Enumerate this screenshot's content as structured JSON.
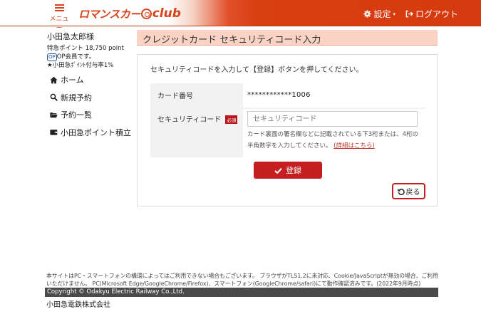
{
  "header": {
    "menu_label": "メニュー",
    "logo_romance": "ロマンスカー",
    "logo_club": "club",
    "settings_label": "設定",
    "logout_label": "ログアウト"
  },
  "user": {
    "name": "小田急太郎様",
    "points_line": "特急ポイント 18,750 point",
    "op_badge": "OP",
    "member_line": "OP会員です。",
    "rate_line": "★小田急ﾎﾟｲﾝﾄ付与率1%"
  },
  "sidebar": {
    "items": [
      {
        "label": "ホーム"
      },
      {
        "label": "新規予約"
      },
      {
        "label": "予約一覧"
      },
      {
        "label": "小田急ポイント積立"
      }
    ]
  },
  "page": {
    "title": "クレジットカード セキュリティコード入力",
    "intro": "セキュリティコードを入力して【登録】ボタンを押してください。"
  },
  "form": {
    "card_number_label": "カード番号",
    "card_number_value": "************1006",
    "security_code_label": "セキュリティコード",
    "required_badge": "必須",
    "security_code_placeholder": "セキュリティコード",
    "help_text": "カード裏面の署名欄などに記載されている下3桁または、4桁の半角数字を入力してください。",
    "help_link": "(詳細はこちら)"
  },
  "buttons": {
    "register": "登録",
    "back": "戻る"
  },
  "footer": {
    "notice": "本サイトはPC・スマートフォンの構環によってはご利用できない場合もございます。 ブラウザがTLS1.2に未対応、Cookie/JavaScriptが無効の場合、ご利用いただけません。 PC(Microsoft Edge/GoogleChrome/Firefox)、スマートフォン(GoogleChrome/safari)にて動作確認済みです。(2022年9月時点)",
    "copyright": "Copyright © Odakyu Electric Railway Co.,Ltd.",
    "company": "小田急電鉄株式会社"
  },
  "colors": {
    "brand": "#d8431b",
    "title_bar": "#fbd3c5",
    "button_red": "#c41e20"
  }
}
